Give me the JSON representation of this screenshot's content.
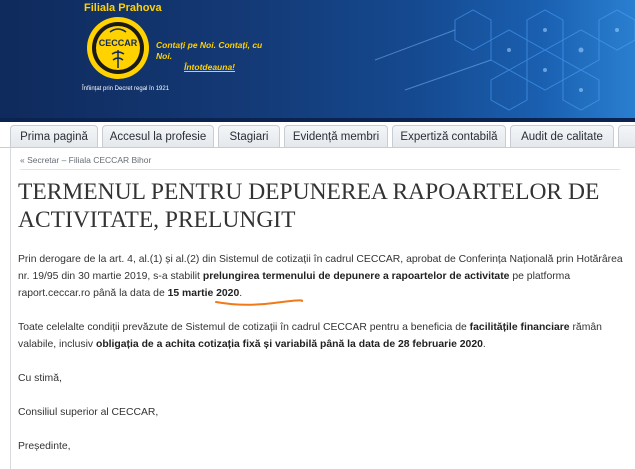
{
  "header": {
    "branch_title": "Filiala Prahova",
    "logo_text": "CECCAR",
    "slogan_line1": "Contați pe Noi. Contați, cu Noi.",
    "slogan_line2": "Întotdeauna!",
    "founded": "Înființat prin Decret regal în 1921"
  },
  "nav": {
    "tabs": [
      {
        "label": "Prima pagină"
      },
      {
        "label": "Accesul la profesie"
      },
      {
        "label": "Stagiari"
      },
      {
        "label": "Evidență membri"
      },
      {
        "label": "Expertiză contabilă"
      },
      {
        "label": "Audit de calitate"
      }
    ]
  },
  "breadcrumb": {
    "prefix": "« ",
    "text": "Secretar – Filiala CECCAR Bihor"
  },
  "article": {
    "title": "TERMENUL PENTRU DEPUNEREA RAPOARTELOR DE ACTIVITATE, PRELUNGIT",
    "p1_a": "Prin derogare de la art. 4, al.(1) și al.(2) din Sistemul de cotizații în cadrul CECCAR, aprobat de Conferința Națională prin Hotărârea nr. 19/95 din 30 martie 2019, s-a stabilit ",
    "p1_b": "prelungirea termenului de depunere a rapoartelor de activitate",
    "p1_c": " pe platforma raport.ceccar.ro până la data de ",
    "p1_d": "15 martie 2020",
    "p1_e": ".",
    "p2_a": "Toate celelalte condiții prevăzute de Sistemul de cotizații în cadrul CECCAR pentru a beneficia de ",
    "p2_b": "facilitățile financiare",
    "p2_c": " rămân valabile, inclusiv ",
    "p2_d": "obligația de a achita cotizația fixă și variabilă până la data de 28 februarie 2020",
    "p2_e": ".",
    "closing": "Cu stimă,",
    "signature": "Consiliul superior al CECCAR,",
    "role": "Președinte,"
  },
  "colors": {
    "banner_dark": "#0f2a5c",
    "banner_light": "#2a7fd0",
    "brand_yellow": "#ffd200",
    "highlight_underline": "#f07a1a",
    "text": "#333333"
  }
}
